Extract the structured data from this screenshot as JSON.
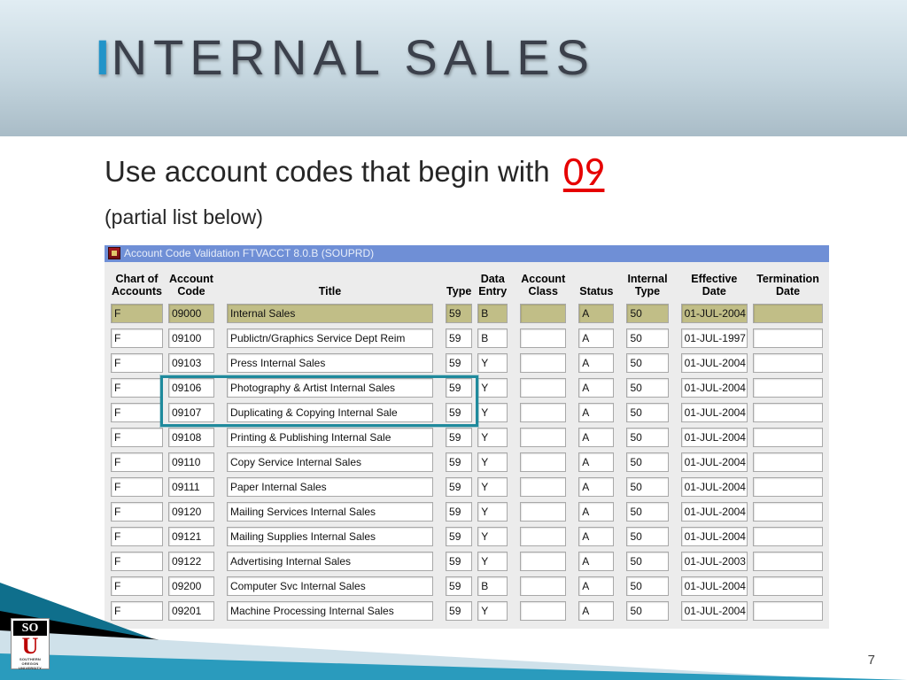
{
  "slide": {
    "title_rest": "NTERNAL SALES",
    "title_first_letter": "I",
    "lead": "Use account codes that begin with",
    "lead_code": "09",
    "sub": "(partial list below)",
    "page_number": "7"
  },
  "window": {
    "title": "Account Code Validation  FTVACCT 8.0.B  (SOUPRD)",
    "columns": {
      "coa": "Chart of Accounts",
      "code": "Account Code",
      "title": "Title",
      "type": "Type",
      "dataentry": "Data Entry",
      "acctclass": "Account Class",
      "status": "Status",
      "itype": "Internal Type",
      "effdate": "Effective Date",
      "termdate": "Termination Date"
    },
    "rows": [
      {
        "coa": "F",
        "code": "09000",
        "title": "Internal Sales",
        "type": "59",
        "de": "B",
        "ac": "",
        "status": "A",
        "itype": "50",
        "eff": "01-JUL-2004",
        "term": "",
        "hl": true
      },
      {
        "coa": "F",
        "code": "09100",
        "title": "Publictn/Graphics Service Dept Reim",
        "type": "59",
        "de": "B",
        "ac": "",
        "status": "A",
        "itype": "50",
        "eff": "01-JUL-1997",
        "term": ""
      },
      {
        "coa": "F",
        "code": "09103",
        "title": "Press Internal Sales",
        "type": "59",
        "de": "Y",
        "ac": "",
        "status": "A",
        "itype": "50",
        "eff": "01-JUL-2004",
        "term": ""
      },
      {
        "coa": "F",
        "code": "09106",
        "title": "Photography & Artist Internal Sales",
        "type": "59",
        "de": "Y",
        "ac": "",
        "status": "A",
        "itype": "50",
        "eff": "01-JUL-2004",
        "term": ""
      },
      {
        "coa": "F",
        "code": "09107",
        "title": "Duplicating & Copying Internal Sale",
        "type": "59",
        "de": "Y",
        "ac": "",
        "status": "A",
        "itype": "50",
        "eff": "01-JUL-2004",
        "term": ""
      },
      {
        "coa": "F",
        "code": "09108",
        "title": "Printing & Publishing Internal Sale",
        "type": "59",
        "de": "Y",
        "ac": "",
        "status": "A",
        "itype": "50",
        "eff": "01-JUL-2004",
        "term": ""
      },
      {
        "coa": "F",
        "code": "09110",
        "title": "Copy Service Internal Sales",
        "type": "59",
        "de": "Y",
        "ac": "",
        "status": "A",
        "itype": "50",
        "eff": "01-JUL-2004",
        "term": ""
      },
      {
        "coa": "F",
        "code": "09111",
        "title": "Paper Internal Sales",
        "type": "59",
        "de": "Y",
        "ac": "",
        "status": "A",
        "itype": "50",
        "eff": "01-JUL-2004",
        "term": ""
      },
      {
        "coa": "F",
        "code": "09120",
        "title": "Mailing Services Internal Sales",
        "type": "59",
        "de": "Y",
        "ac": "",
        "status": "A",
        "itype": "50",
        "eff": "01-JUL-2004",
        "term": ""
      },
      {
        "coa": "F",
        "code": "09121",
        "title": "Mailing Supplies Internal Sales",
        "type": "59",
        "de": "Y",
        "ac": "",
        "status": "A",
        "itype": "50",
        "eff": "01-JUL-2004",
        "term": ""
      },
      {
        "coa": "F",
        "code": "09122",
        "title": "Advertising Internal Sales",
        "type": "59",
        "de": "Y",
        "ac": "",
        "status": "A",
        "itype": "50",
        "eff": "01-JUL-2003",
        "term": ""
      },
      {
        "coa": "F",
        "code": "09200",
        "title": "Computer Svc Internal Sales",
        "type": "59",
        "de": "B",
        "ac": "",
        "status": "A",
        "itype": "50",
        "eff": "01-JUL-2004",
        "term": ""
      },
      {
        "coa": "F",
        "code": "09201",
        "title": "Machine Processing Internal Sales",
        "type": "59",
        "de": "Y",
        "ac": "",
        "status": "A",
        "itype": "50",
        "eff": "01-JUL-2004",
        "term": ""
      }
    ]
  },
  "logo": {
    "so": "SO",
    "u": "U",
    "caption": "Southern Oregon University"
  }
}
